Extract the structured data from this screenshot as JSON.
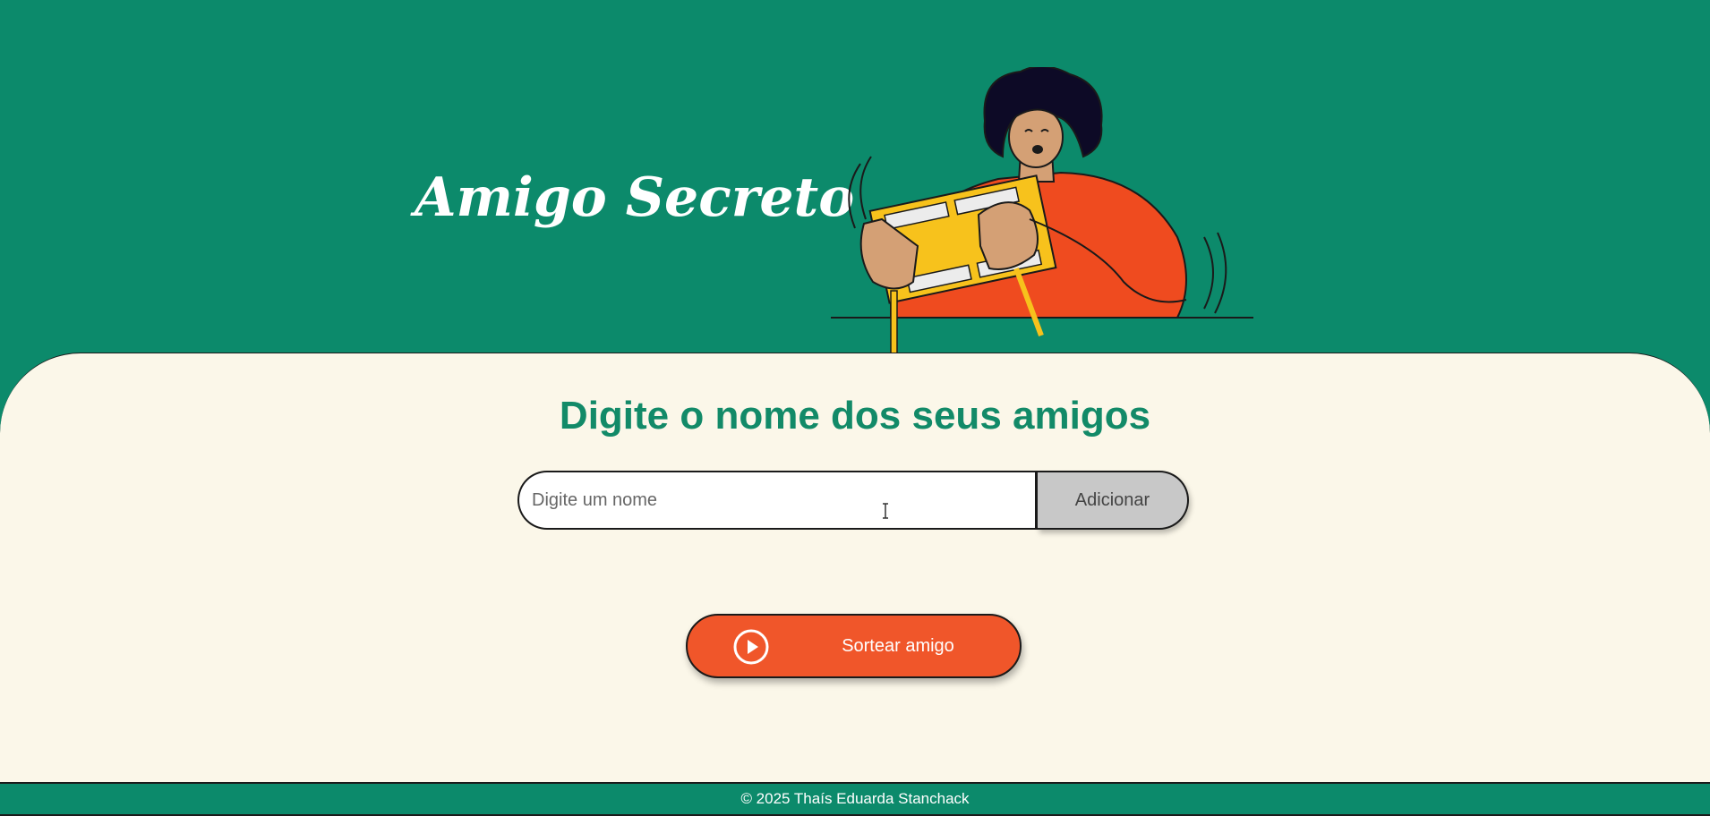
{
  "header": {
    "title": "Amigo Secreto"
  },
  "main": {
    "subtitle": "Digite o nome dos seus amigos",
    "input": {
      "placeholder": "Digite um nome",
      "value": ""
    },
    "add_button_label": "Adicionar",
    "draw_button_label": "Sortear amigo"
  },
  "footer": {
    "text": "© 2025 Thaís Eduarda Stanchack"
  },
  "colors": {
    "header_bg": "#0c8a6b",
    "main_bg": "#fbf7e9",
    "subtitle": "#128a68",
    "draw_button": "#f0562a",
    "add_button": "#c8c8c8"
  },
  "icons": {
    "draw_button_icon": "play-circle-icon",
    "cursor": "text-cursor-icon"
  }
}
